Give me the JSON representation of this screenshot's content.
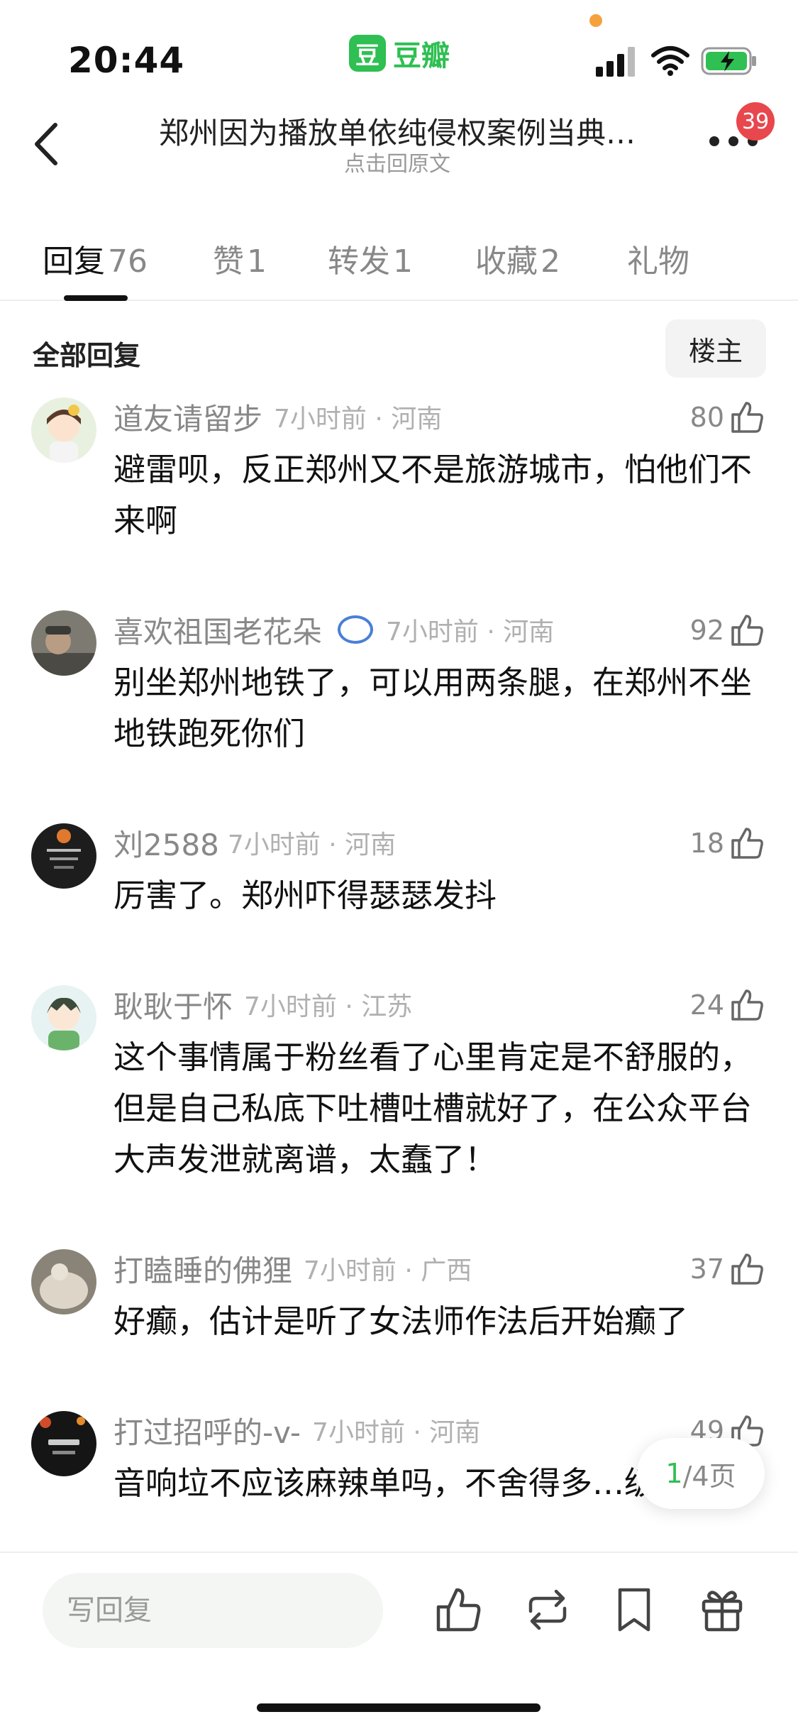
{
  "status_bar": {
    "time": "20:44",
    "app_name": "豆瓣",
    "app_logo_char": "豆"
  },
  "header": {
    "title": "郑州因为播放单依纯侵权案例当典…",
    "subtitle": "点击回原文",
    "notification_count": "39"
  },
  "tabs": [
    {
      "label": "回复",
      "count": "76",
      "active": true
    },
    {
      "label": "赞",
      "count": "1"
    },
    {
      "label": "转发",
      "count": "1"
    },
    {
      "label": "收藏",
      "count": "2"
    },
    {
      "label": "礼物",
      "count": ""
    }
  ],
  "section": {
    "title": "全部回复",
    "owner_button": "楼主"
  },
  "comments": [
    {
      "user": "道友请留步",
      "time_loc": "7小时前 · 河南",
      "likes": "80",
      "text": "避雷呗，反正郑州又不是旅游城市，怕他们不来啊"
    },
    {
      "user": "喜欢祖国老花朵",
      "time_loc": "7小时前 · 河南",
      "likes": "92",
      "text": "别坐郑州地铁了，可以用两条腿，在郑州不坐地铁跑死你们"
    },
    {
      "user": "刘2588",
      "time_loc": "7小时前 · 河南",
      "likes": "18",
      "text": "厉害了。郑州吓得瑟瑟发抖"
    },
    {
      "user": "耿耿于怀",
      "time_loc": "7小时前 · 江苏",
      "likes": "24",
      "text": "这个事情属于粉丝看了心里肯定是不舒服的，但是自己私底下吐槽吐槽就好了，在公众平台大声发泄就离谱，太蠢了！"
    },
    {
      "user": "打瞌睡的佛狸",
      "time_loc": "7小时前 · 广西",
      "likes": "37",
      "text": "好癫，估计是听了女法师作法后开始癫了"
    },
    {
      "user": "打过招呼的-v-",
      "time_loc": "7小时前 · 河南",
      "likes": "49",
      "text": "音响垃不应该麻辣单吗，不舍得多…级配置"
    }
  ],
  "pagination": {
    "current": "1",
    "total_text": "/4页"
  },
  "bottom_bar": {
    "reply_placeholder": "写回复"
  },
  "colors": {
    "brand_green": "#2fbf52",
    "badge_red": "#e8474d",
    "orange_dot": "#f5a23c"
  }
}
